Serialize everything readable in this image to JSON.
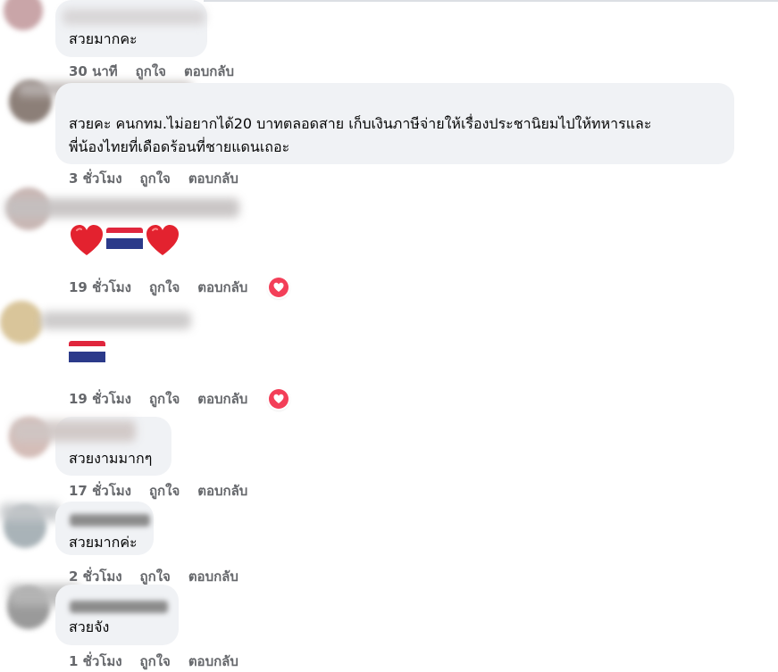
{
  "comments": [
    {
      "text": "สวยมากคะ",
      "time": "30 นาที",
      "like": "ถูกใจ",
      "reply": "ตอบกลับ"
    },
    {
      "text_line1": "สวยคะ คนกทม.ไม่อยากได้20 บาทตลอดสาย เก็บเงินภาษีจ่ายให้เรื่องประชานิยมไปให้ทหารและ",
      "text_line2": "พี่น้องไทยที่เดือดร้อนที่ชายแดนเถอะ",
      "time": "3 ชั่วโมง",
      "like": "ถูกใจ",
      "reply": "ตอบกลับ"
    },
    {
      "emojis": [
        "red-heart",
        "thai-flag",
        "red-heart"
      ],
      "time": "19 ชั่วโมง",
      "like": "ถูกใจ",
      "reply": "ตอบกลับ",
      "reaction": "love"
    },
    {
      "emojis": [
        "thai-flag"
      ],
      "time": "19 ชั่วโมง",
      "like": "ถูกใจ",
      "reply": "ตอบกลับ",
      "reaction": "love"
    },
    {
      "text": "สวยงามมากๆ",
      "time": "17 ชั่วโมง",
      "like": "ถูกใจ",
      "reply": "ตอบกลับ"
    },
    {
      "text": "สวยมากค่ะ",
      "time": "2 ชั่วโมง",
      "like": "ถูกใจ",
      "reply": "ตอบกลับ"
    },
    {
      "text": "สวยจัง",
      "time": "1 ชั่วโมง",
      "like": "ถูกใจ",
      "reply": "ตอบกลับ"
    }
  ],
  "colors": {
    "bubble": "#f0f2f5",
    "meta_text": "#65676b",
    "love_reaction": "#f33e58",
    "flag_red": "#e0263d",
    "flag_white": "#ffffff",
    "flag_blue": "#2b3a8a"
  }
}
